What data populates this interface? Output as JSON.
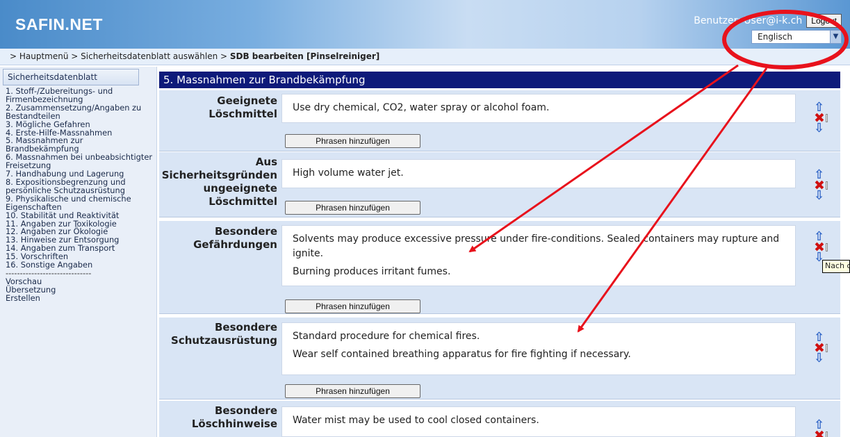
{
  "header": {
    "brand": "SAFIN.NET",
    "user_text": "Benutzer: User@i-k.ch",
    "logout_label": "Logout",
    "language_selected": "Englisch"
  },
  "breadcrumb": {
    "prefix": "> Hauptmenü > Sicherheitsdatenblatt auswählen > ",
    "current": "SDB bearbeiten [Pinselreiniger]"
  },
  "sidebar": {
    "tab_label": "Sicherheitsdatenblatt",
    "items": [
      "1. Stoff-/Zubereitungs- und Firmenbezeichnung",
      "2. Zusammensetzung/Angaben zu Bestandteilen",
      "3. Mögliche Gefahren",
      "4. Erste-Hilfe-Massnahmen",
      "5. Massnahmen zur Brandbekämpfung",
      "6. Massnahmen bei unbeabsichtigter Freisetzung",
      "7. Handhabung und Lagerung",
      "8. Expositionsbegrenzung und persönliche Schutzausrüstung",
      "9. Physikalische und chemische Eigenschaften",
      "10. Stabilität und Reaktivität",
      "11. Angaben zur Toxikologie",
      "12. Angaben zur Ökologie",
      "13. Hinweise zur Entsorgung",
      "14. Angaben zum Transport",
      "15. Vorschriften",
      "16. Sonstige Angaben"
    ],
    "separator": "------------------------------",
    "extra_items": [
      "Vorschau",
      "Übersetzung",
      "Erstellen"
    ]
  },
  "section": {
    "title": "5. Massnahmen zur Brandbekämpfung",
    "button_label": "Phrasen hinzufügen",
    "tooltip": "Nach oben",
    "rows": [
      {
        "label": "Geeignete Löschmittel",
        "lines": [
          "Use dry chemical, CO2, water spray or alcohol foam."
        ]
      },
      {
        "label": "Aus Sicherheitsgründen ungeeignete Löschmittel",
        "lines": [
          "High volume water jet."
        ]
      },
      {
        "label": "Besondere Gefährdungen",
        "lines": [
          "Solvents may produce excessive pressure under fire-conditions. Sealed containers may rupture and ignite.",
          "Burning produces irritant fumes."
        ]
      },
      {
        "label": "Besondere Schutzausrüstung",
        "lines": [
          "Standard procedure for chemical fires.",
          "Wear self contained breathing apparatus for fire fighting if necessary."
        ]
      },
      {
        "label": "Besondere Löschhinweise",
        "lines": [
          "Water mist may be used to cool closed containers."
        ]
      }
    ]
  },
  "annotation": {
    "color": "#e8121c"
  }
}
